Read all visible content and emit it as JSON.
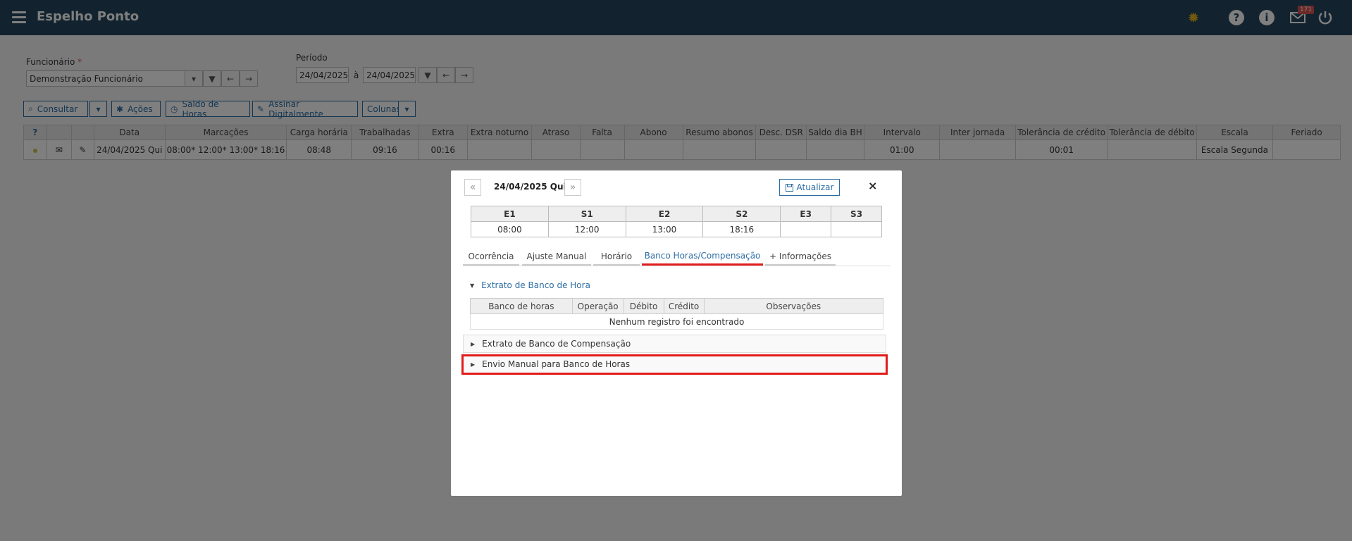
{
  "header": {
    "title": "Espelho Ponto",
    "notif_count": "171"
  },
  "filters": {
    "employee_label": "Funcionário",
    "required_mark": "*",
    "employee_value": "Demonstração Funcionário",
    "period_label": "Período",
    "date_from": "24/04/2025",
    "date_sep": "à",
    "date_to": "24/04/2025"
  },
  "toolbar": {
    "consult": "Consultar",
    "actions": "Ações",
    "balance": "Saldo de Horas",
    "sign": "Assinar Digitalmente",
    "columns": "Colunas"
  },
  "table": {
    "help_header": "?",
    "headers": [
      "Data",
      "Marcações",
      "Carga horária",
      "Trabalhadas",
      "Extra",
      "Extra noturno",
      "Atraso",
      "Falta",
      "Abono",
      "Resumo abonos",
      "Desc. DSR",
      "Saldo dia BH",
      "Intervalo",
      "Inter jornada",
      "Tolerância de crédito",
      "Tolerância de débito",
      "Escala",
      "Feriado"
    ],
    "row": [
      "24/04/2025 Qui",
      "08:00* 12:00* 13:00* 18:16",
      "08:48",
      "09:16",
      "00:16",
      "",
      "",
      "",
      "",
      "",
      "",
      "",
      "01:00",
      "",
      "00:01",
      "",
      "Escala Segunda",
      ""
    ]
  },
  "modal": {
    "prev": "«",
    "next": "»",
    "date": "24/04/2025 Qui",
    "update_label": "Atualizar",
    "close": "×",
    "punch_headers": [
      "E1",
      "S1",
      "E2",
      "S2",
      "E3",
      "S3"
    ],
    "punch_values": [
      "08:00",
      "12:00",
      "13:00",
      "18:16",
      "",
      ""
    ],
    "tabs": [
      "Ocorrência",
      "Ajuste Manual",
      "Horário",
      "Banco Horas/Compensação",
      "+ Informações"
    ],
    "section1_title": "Extrato de Banco de Hora",
    "bh_headers": [
      "Banco de horas",
      "Operação",
      "Débito",
      "Crédito",
      "Observações"
    ],
    "empty_message": "Nenhum registro foi encontrado",
    "section2_title": "Extrato de Banco de Compensação",
    "section3_title": "Envio Manual para Banco de Horas"
  }
}
